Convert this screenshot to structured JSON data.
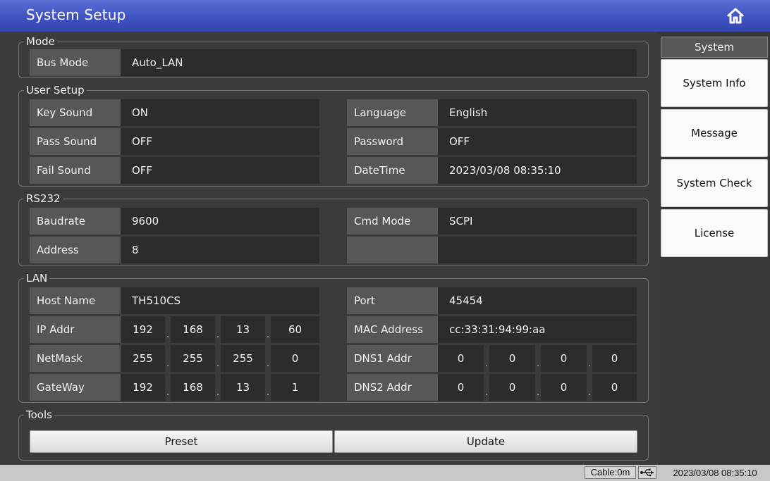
{
  "header": {
    "title": "System Setup",
    "home_icon": "home-icon"
  },
  "mode": {
    "legend": "Mode",
    "bus_mode_label": "Bus Mode",
    "bus_mode_value": "Auto_LAN"
  },
  "user_setup": {
    "legend": "User Setup",
    "key_sound_label": "Key Sound",
    "key_sound_value": "ON",
    "pass_sound_label": "Pass Sound",
    "pass_sound_value": "OFF",
    "fail_sound_label": "Fail Sound",
    "fail_sound_value": "OFF",
    "language_label": "Language",
    "language_value": "English",
    "password_label": "Password",
    "password_value": "OFF",
    "datetime_label": "DateTime",
    "datetime_value": "2023/03/08 08:35:10"
  },
  "rs232": {
    "legend": "RS232",
    "baudrate_label": "Baudrate",
    "baudrate_value": "9600",
    "address_label": "Address",
    "address_value": "8",
    "cmd_mode_label": "Cmd Mode",
    "cmd_mode_value": "SCPI"
  },
  "lan": {
    "legend": "LAN",
    "host_name_label": "Host Name",
    "host_name_value": "TH510CS",
    "ip_label": "IP Addr",
    "ip": [
      "192",
      "168",
      "13",
      "60"
    ],
    "netmask_label": "NetMask",
    "netmask": [
      "255",
      "255",
      "255",
      "0"
    ],
    "gateway_label": "GateWay",
    "gateway": [
      "192",
      "168",
      "13",
      "1"
    ],
    "port_label": "Port",
    "port_value": "45454",
    "mac_label": "MAC Address",
    "mac_value": "cc:33:31:94:99:aa",
    "dns1_label": "DNS1 Addr",
    "dns1": [
      "0",
      "0",
      "0",
      "0"
    ],
    "dns2_label": "DNS2 Addr",
    "dns2": [
      "0",
      "0",
      "0",
      "0"
    ],
    "separator": "."
  },
  "tools": {
    "legend": "Tools",
    "preset_label": "Preset",
    "update_label": "Update"
  },
  "sidebar": {
    "header": "System",
    "items": [
      {
        "label": "System Info"
      },
      {
        "label": "Message"
      },
      {
        "label": "System Check"
      },
      {
        "label": "License"
      }
    ]
  },
  "statusbar": {
    "cable": "Cable:0m",
    "usb_icon": "usb-icon",
    "clock": "2023/03/08 08:35:10"
  },
  "colors": {
    "titlebar": "#4358c4",
    "panel": "#3d3b3a",
    "label_cell": "#5a5653",
    "value_cell": "#2e2b2a"
  }
}
